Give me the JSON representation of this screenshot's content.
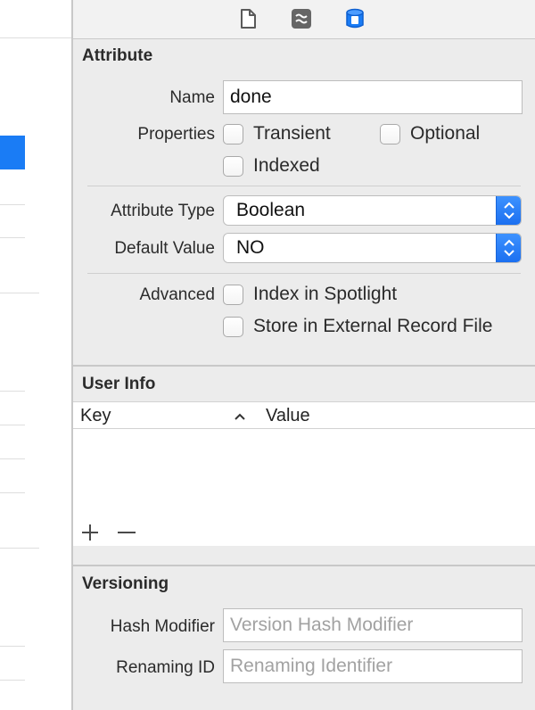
{
  "toolbar": {
    "tabs": [
      {
        "name": "file-inspector-icon"
      },
      {
        "name": "quick-help-icon"
      },
      {
        "name": "data-model-inspector-icon"
      }
    ]
  },
  "attribute": {
    "section_title": "Attribute",
    "name_label": "Name",
    "name_value": "done",
    "properties_label": "Properties",
    "transient_label": "Transient",
    "optional_label": "Optional",
    "indexed_label": "Indexed",
    "type_label": "Attribute Type",
    "type_value": "Boolean",
    "default_label": "Default Value",
    "default_value": "NO",
    "advanced_label": "Advanced",
    "spotlight_label": "Index in Spotlight",
    "external_label": "Store in External Record File"
  },
  "user_info": {
    "section_title": "User Info",
    "key_header": "Key",
    "value_header": "Value",
    "add_symbol": "+",
    "remove_symbol": "−"
  },
  "versioning": {
    "section_title": "Versioning",
    "hash_label": "Hash Modifier",
    "hash_placeholder": "Version Hash Modifier",
    "renaming_label": "Renaming ID",
    "renaming_placeholder": "Renaming Identifier"
  },
  "colors": {
    "accent": "#1a7cf5",
    "panel_bg": "#ececec"
  }
}
